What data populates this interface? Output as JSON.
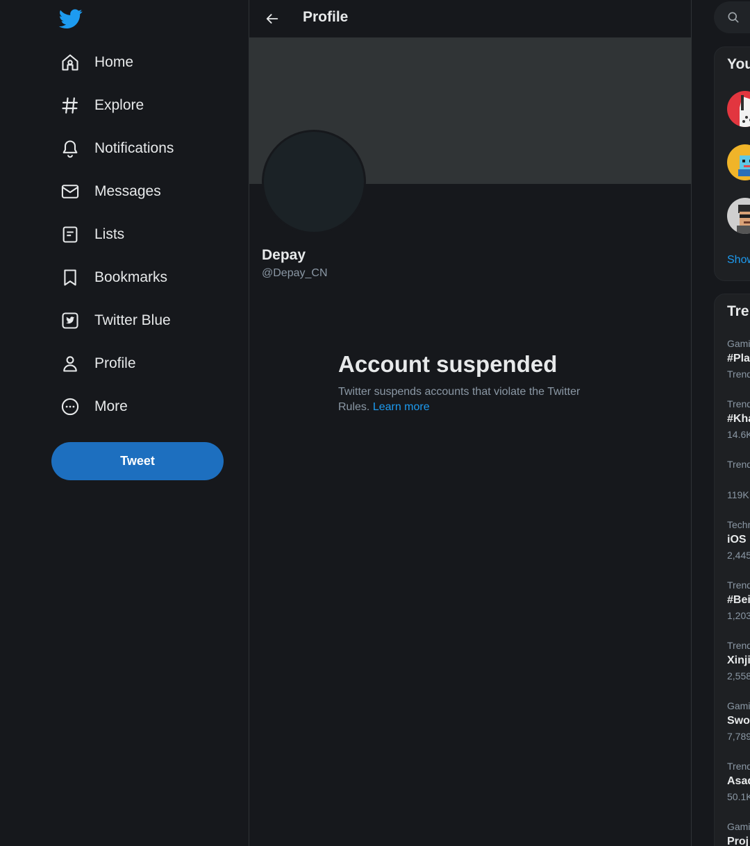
{
  "colors": {
    "accent": "#1d9bf0",
    "tweet_button": "#1d6fbf",
    "background": "#16181c",
    "banner": "#303436",
    "text_primary": "#e7e9ea",
    "text_secondary": "#8b98a5"
  },
  "sidebar": {
    "logo": "twitter-bird-icon",
    "items": [
      {
        "label": "Home",
        "icon": "home-icon"
      },
      {
        "label": "Explore",
        "icon": "hashtag-icon"
      },
      {
        "label": "Notifications",
        "icon": "bell-icon"
      },
      {
        "label": "Messages",
        "icon": "envelope-icon"
      },
      {
        "label": "Lists",
        "icon": "list-icon"
      },
      {
        "label": "Bookmarks",
        "icon": "bookmark-icon"
      },
      {
        "label": "Twitter Blue",
        "icon": "twitter-blue-icon"
      },
      {
        "label": "Profile",
        "icon": "person-icon"
      },
      {
        "label": "More",
        "icon": "more-circle-icon"
      }
    ],
    "tweet_label": "Tweet"
  },
  "header": {
    "title": "Profile",
    "back_icon": "arrow-left-icon"
  },
  "profile": {
    "display_name": "Depay",
    "handle": "@Depay_CN"
  },
  "suspension": {
    "title": "Account suspended",
    "body": "Twitter suspends accounts that violate the Twitter Rules.",
    "link": "Learn more"
  },
  "right": {
    "search_icon": "search-icon",
    "who_to_follow_title": "You",
    "show_more": "Show",
    "trends_title": "Tre",
    "trends": [
      {
        "context": "Gami",
        "name": "#Pla",
        "count": "Trend"
      },
      {
        "context": "Trend",
        "name": "#Kha",
        "count": "14.6K"
      },
      {
        "context": "Trend",
        "name": "",
        "count": "119K"
      },
      {
        "context": "Techn",
        "name": "iOS",
        "count": "2,445"
      },
      {
        "context": "Trend",
        "name": "#Bei",
        "count": "1,203"
      },
      {
        "context": "Trend",
        "name": "Xinji",
        "count": "2,558"
      },
      {
        "context": "Gami",
        "name": "Swo",
        "count": "7,789"
      },
      {
        "context": "Trend",
        "name": "Asad",
        "count": "50.1K"
      },
      {
        "context": "Gami",
        "name": "Proj",
        "count": ""
      }
    ]
  }
}
